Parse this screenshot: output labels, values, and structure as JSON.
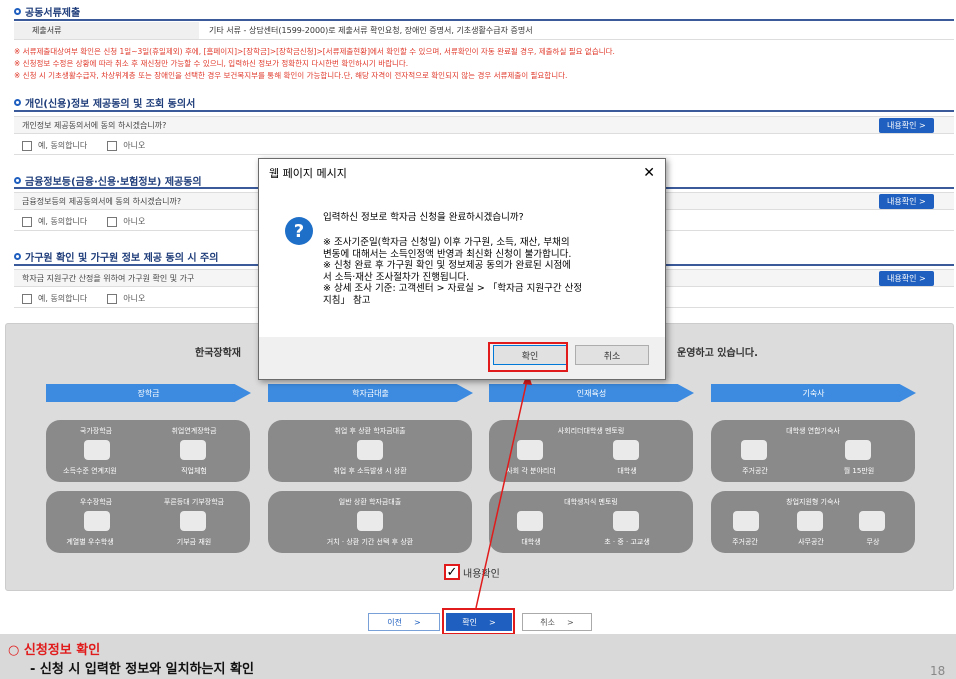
{
  "section1": {
    "title": "공동서류제출",
    "doc_label": "제출서류",
    "doc_value": "기타 서류 - 상담센터(1599-2000)로 제출서류 확인요청, 장애인 증명서, 기초생활수급자 증명서"
  },
  "notes": [
    "※ 서류제출대상여부 확인은 신청 1일~3일(휴일제외) 후에, [홈페이지]>[장학금]>[장학금신청]>[서류제출현황]에서 확인할 수 있으며, 서류확인이 자동 완료될 경우, 제출하실 필요 없습니다.",
    "※ 신청정보 수정은 상황에 따라 취소 후 재신청만 가능할 수 있으니, 입력하신 정보가 정확한지 다시한번 확인하시기 바랍니다.",
    "※ 신청 시 기초생활수급자, 차상위계층 또는 장애인을 선택한 경우 보건복지부를 통해 확인이 가능합니다.단, 해당 자격이 전자적으로 확인되지 않는 경우 서류제출이 필요합니다."
  ],
  "section2": {
    "title": "개인(신용)정보 제공동의 및 조회 동의서",
    "question": "개인정보 제공동의서에 동의 하시겠습니까?",
    "button": "내용확인 >",
    "agree": "예, 동의합니다",
    "disagree": "아니오"
  },
  "section3": {
    "title": "금융정보등(금융·신용·보험정보) 제공동의",
    "question": "금융정보등의 제공동의서에 동의 하시겠습니까?",
    "button": "내용확인 >",
    "agree": "예, 동의합니다",
    "disagree": "아니오"
  },
  "section4": {
    "title": "가구원 확인 및 가구원 정보 제공 동의 시 주의",
    "question": "학자금 지원구간 산정을 위하여 가구원 확인 및 가구",
    "button": "내용확인 >",
    "agree": "예, 동의합니다",
    "disagree": "아니오"
  },
  "panel": {
    "heading_left": "한국장학재",
    "heading_right": "운영하고 있습니다.",
    "tabs": [
      "장학금",
      "학자금대출",
      "인재육성",
      "기숙사"
    ],
    "cards": [
      {
        "title_a": "국가장학금",
        "title_b": "취업연계장학금",
        "sub_a": "소득수준 연계지원",
        "sub_b": "직업체험"
      },
      {
        "title_a": "우수장학금",
        "title_b": "푸른등대 기부장학금",
        "sub_a": "계열별 우수학생",
        "sub_b": "기부금 재원"
      },
      {
        "title": "취업 후 상환 학자금대출",
        "sub": "취업 후 소득발생 시 상환"
      },
      {
        "title": "일반 상환 학자금대출",
        "sub": "거치 · 상환 기간 선택 후 상환"
      },
      {
        "title": "사회리더대학생 멘토링",
        "sub_a": "사회 각 분야리더",
        "sub_b": "대학생"
      },
      {
        "title": "대학생지식 멘토링",
        "sub_a": "대학생",
        "sub_b": "초 · 중 · 고교생"
      },
      {
        "title": "대학생 연합기숙사",
        "sub_a": "주거공간",
        "sub_b": "월 15만원"
      },
      {
        "title": "창업지원형 기숙사",
        "sub_a": "주거공간",
        "sub_b": "사무공간",
        "sub_c": "무상"
      }
    ],
    "confirm_label": "내용확인"
  },
  "nav": {
    "prev": "이전",
    "confirm": "확인",
    "cancel": "취소"
  },
  "dialog": {
    "title": "웹 페이지 메시지",
    "close": "✕",
    "question": "입력하신 정보로 학자금 신청을 완료하시겠습니까?",
    "lines": [
      "※ 조사기준일(학자금 신청일) 이후 가구원, 소득, 재산, 부채의",
      "변동에 대해서는 소득인정액 반영과 최신화 신청이 불가합니다.",
      "※ 신청 완료 후 가구원 확인 및 정보제공 동의가 완료된 시점에",
      "서 소득·재산 조사절차가 진행됩니다.",
      "※ 상세 조사 기준: 고객센터 > 자료실 > 「학자금 지원구간 산정",
      "지침」 참고"
    ],
    "ok": "확인",
    "cancel": "취소"
  },
  "footer": {
    "title": "○ 신청정보 확인",
    "sub": "- 신청 시 입력한 정보와 일치하는지 확인",
    "page": "18"
  },
  "colors": {
    "accent": "#1f5fbf",
    "red": "#e11b1b",
    "footer_bg": "#d9d9d9"
  }
}
